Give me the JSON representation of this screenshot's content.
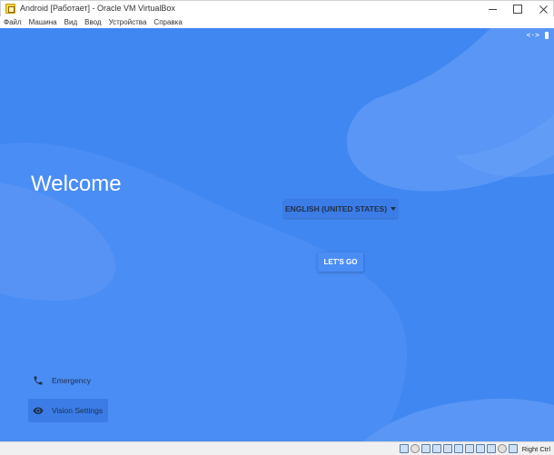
{
  "window": {
    "title": "Android [Работает] - Oracle VM VirtualBox",
    "app_icon": "virtualbox-icon"
  },
  "menubar": {
    "items": [
      "Файл",
      "Машина",
      "Вид",
      "Ввод",
      "Устройства",
      "Справка"
    ]
  },
  "guest": {
    "status_icons": {
      "code": "<·>"
    },
    "welcome_title": "Welcome",
    "language_button": "ENGLISH (UNITED STATES)",
    "start_button": "LET'S GO",
    "emergency_label": "Emergency",
    "vision_label": "Vision Settings",
    "colors": {
      "background": "#4187f2",
      "wave_light": "#5c98f5",
      "text_dark": "#1f2f4a"
    }
  },
  "statusbar": {
    "host_key": "Right Ctrl",
    "tray_icons": [
      "harddisk-icon",
      "optical-drive-icon",
      "audio-icon",
      "network-icon",
      "usb-icon",
      "shared-folders-icon",
      "display-icon",
      "video-capture-icon",
      "mouse-integration-icon",
      "cpu-icon",
      "keyboard-icon"
    ]
  }
}
